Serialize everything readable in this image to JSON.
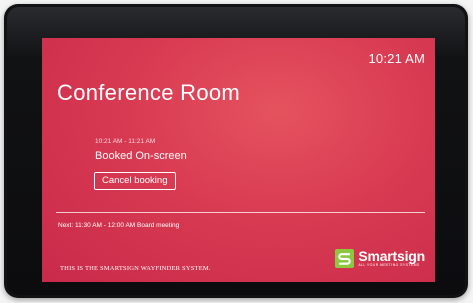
{
  "screen": {
    "clock": "10:21 AM",
    "room_title": "Conference Room",
    "current_booking": {
      "time_range": "10:21 AM - 11:21 AM",
      "status": "Booked On-screen",
      "cancel_label": "Cancel booking"
    },
    "next_meeting": "Next: 11:30 AM - 12:00 AM Board meeting",
    "footer_text": "THIS IS THE SMARTSIGN WAYFINDER SYSTEM.",
    "logo": {
      "name": "Smartsign",
      "tagline": "ALL YOUR MEETING SYSTEMS",
      "icon": "smartsign-logo-icon"
    }
  },
  "colors": {
    "screen_background": "#d83a52",
    "bezel": "#111214",
    "logo_accent": "#8dc63f",
    "text": "#ffffff"
  }
}
